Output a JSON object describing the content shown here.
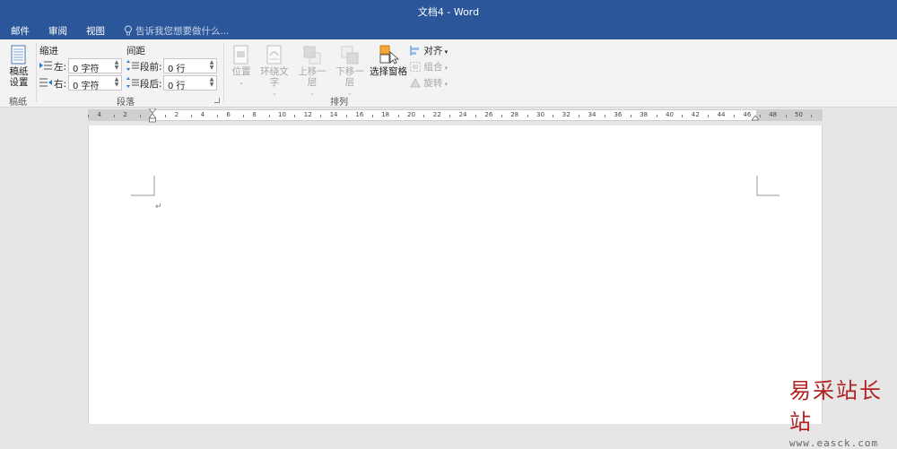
{
  "window": {
    "title": "文档4 - Word"
  },
  "tabs": [
    "邮件",
    "审阅",
    "视图"
  ],
  "tell_me": {
    "placeholder": "告诉我您想要做什么..."
  },
  "ribbon": {
    "manuscript": {
      "button_line1": "稿纸",
      "button_line2": "设置",
      "group_label": "稿纸"
    },
    "paragraph": {
      "indent_label": "缩进",
      "spacing_label": "间距",
      "left_label": "左:",
      "left_value": "0 字符",
      "right_label": "右:",
      "right_value": "0 字符",
      "before_label": "段前:",
      "before_value": "0 行",
      "after_label": "段后:",
      "after_value": "0 行",
      "group_label": "段落"
    },
    "arrange": {
      "position_label": "位置",
      "wrap_label": "环绕文字",
      "forward_label": "上移一层",
      "backward_label": "下移一层",
      "selection_pane_label": "选择窗格",
      "align_label": "对齐",
      "group_btn_label": "组合",
      "rotate_label": "旋转",
      "group_label": "排列"
    }
  },
  "ruler": {
    "labels": [
      "4",
      "2",
      "2",
      "4",
      "6",
      "8",
      "10",
      "12",
      "14",
      "16",
      "18",
      "20",
      "22",
      "24",
      "26",
      "28",
      "30",
      "32",
      "34",
      "36",
      "38",
      "40",
      "42",
      "44",
      "46",
      "48",
      "50"
    ]
  },
  "document": {
    "paragraph_mark": "↵"
  },
  "watermark": {
    "text": "易采站长站",
    "url": "www.easck.com"
  },
  "colors": {
    "accent": "#2b579a",
    "ribbon_bg": "#f3f3f3",
    "workspace_bg": "#e6e6e6",
    "watermark_red": "#b22222"
  }
}
